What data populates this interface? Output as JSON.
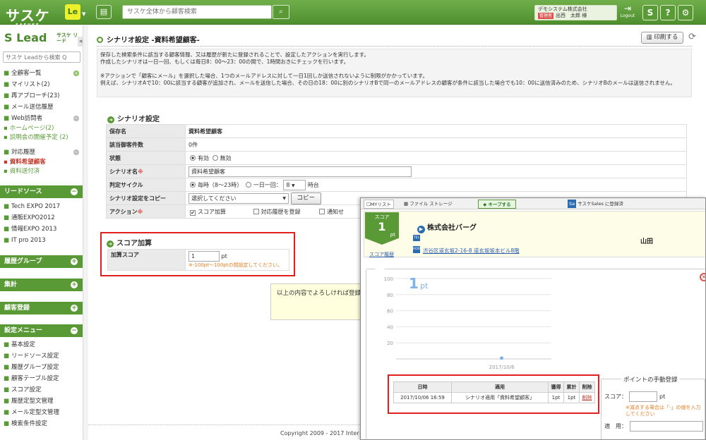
{
  "topbar": {
    "logo": "サスケ",
    "logo_sub": "SASUKE",
    "le_badge": "Le",
    "search_placeholder": "サスケ全体から顧客検索",
    "company": "デモシステム株式会社",
    "admin_badge": "管理者",
    "user_name": "出西　太郎 様",
    "logout": "Logout",
    "help": "?"
  },
  "sidebar": {
    "brand": "Lead",
    "brand_sub": "サスケ リード",
    "search_placeholder": "サスケ Leadから検索 Q",
    "items": [
      {
        "label": "全顧客一覧"
      },
      {
        "label": "マイリスト(2)"
      },
      {
        "label": "再アプローチ(23)"
      },
      {
        "label": "メール送信履歴"
      },
      {
        "label": "Web訪問者"
      },
      {
        "label": "ホームページ(2)"
      },
      {
        "label": "説明会の開催予定 (2)"
      },
      {
        "label": "対応履歴"
      },
      {
        "label": "資料希望顧客"
      },
      {
        "label": "資料送付済"
      }
    ],
    "lead_source_title": "リードソース",
    "lead_sources": [
      "Tech EXPO 2017",
      "通販EXPO2012",
      "情報EXPO 2013",
      "IT pro 2013"
    ],
    "history_group_title": "履歴グループ",
    "aggregate_title": "集計",
    "customer_reg_title": "顧客登録",
    "settings_title": "設定メニュー",
    "settings": [
      "基本設定",
      "リードソース設定",
      "履歴グループ設定",
      "顧客テーブル設定",
      "スコア設定",
      "履歴定型文管理",
      "メール定型文管理",
      "検索条件設定"
    ]
  },
  "main": {
    "page_title": "シナリオ設定 -資料希望顧客-",
    "print_label": "印刷する",
    "notice_1": "保存した検索条件に該当する顧客情報、又は履歴が新たに登録されることで、設定したアクションを実行します。",
    "notice_2": "作成したシナリオは一日一回、もしくは毎日8：00〜23：00の間で、1時間おきにチェックを行います。",
    "notice_3": "※アクションで「顧客にメール」を選択した場合、1つのメールアドレスに対して一日1回しか送信されないように制限がかかっています。",
    "notice_4": "例えば、シナリオAで10：00に該当する顧客が追加され、メールを送信した場合、その日の18：00に別のシナリオBで同一のメールアドレスの顧客が条件に該当した場合でも10：00に送信済みのため、シナリオBのメールは送信されません。",
    "scenario_section": "シナリオ設定",
    "rows": {
      "saved_name_label": "保存名",
      "saved_name_value": "資料希望顧客",
      "count_label": "該当御客件数",
      "count_value": "0件",
      "status_label": "状態",
      "status_on": "有効",
      "status_off": "無効",
      "scenario_name_label": "シナリオ名",
      "scenario_name_value": "資料希望顧客",
      "cycle_label": "判定サイクル",
      "cycle_hourly": "毎時（8〜23時）",
      "cycle_daily": "一日一回：",
      "cycle_hour_value": "8",
      "cycle_hour_unit": "時台",
      "copy_label": "シナリオ設定をコピー",
      "copy_select": "選択してください",
      "copy_button": "コピー",
      "action_label": "アクション",
      "action_score": "スコア加算",
      "action_history": "対応履歴を登録",
      "action_notify": "通知せ"
    },
    "score_section": "スコア加算",
    "score_label": "加算スコア",
    "score_value": "1",
    "score_unit": "pt",
    "score_hint": "※-100pt〜100ptの間設定してください。",
    "confirm_text": "以上の内容でよろしければ登録",
    "copyright": "Copyright 2009 - 2017 Inter"
  },
  "popup": {
    "tabs": {
      "mylist": "MYリスト",
      "storage": "ファイル ストレージ",
      "keep": "キープする",
      "sales": "サスケSales に登録済"
    },
    "score_label": "スコア",
    "score_value": "1",
    "score_unit": "pt",
    "score_history": "スコア履歴",
    "company": "株式会社バーグ",
    "person": "山田",
    "tel_icon": "TEL",
    "addr_icon": "ADD",
    "address": "渋谷区道玄坂2-16-8 道玄坂坂本ビル8階",
    "history": {
      "headers": [
        "日時",
        "適用",
        "獲得",
        "累計",
        "削除"
      ],
      "rows": [
        {
          "date": "2017/10/06 16:59",
          "apply": "シナリオ適用「資料希望顧客」",
          "gain": "1pt",
          "total": "1pt",
          "del": "削除"
        }
      ]
    },
    "manual": {
      "legend": "ポイントの手動登録",
      "score_label": "スコア：",
      "unit": "pt",
      "note": "※減点する場合は「-」の値を入力してください",
      "apply_label": "適　用："
    }
  },
  "chart_data": {
    "type": "line",
    "x": [
      "2017/10/6"
    ],
    "series": [
      {
        "values": [
          1
        ]
      }
    ],
    "current_value": "1",
    "current_unit": "pt",
    "yticks": [
      20,
      40,
      60,
      80,
      100
    ],
    "ylim": [
      0,
      100
    ],
    "xtick_label": "2017/10/6",
    "grid": true,
    "colors": {
      "point": "#7fb3e8",
      "big_number": "#7fb3e8"
    }
  }
}
